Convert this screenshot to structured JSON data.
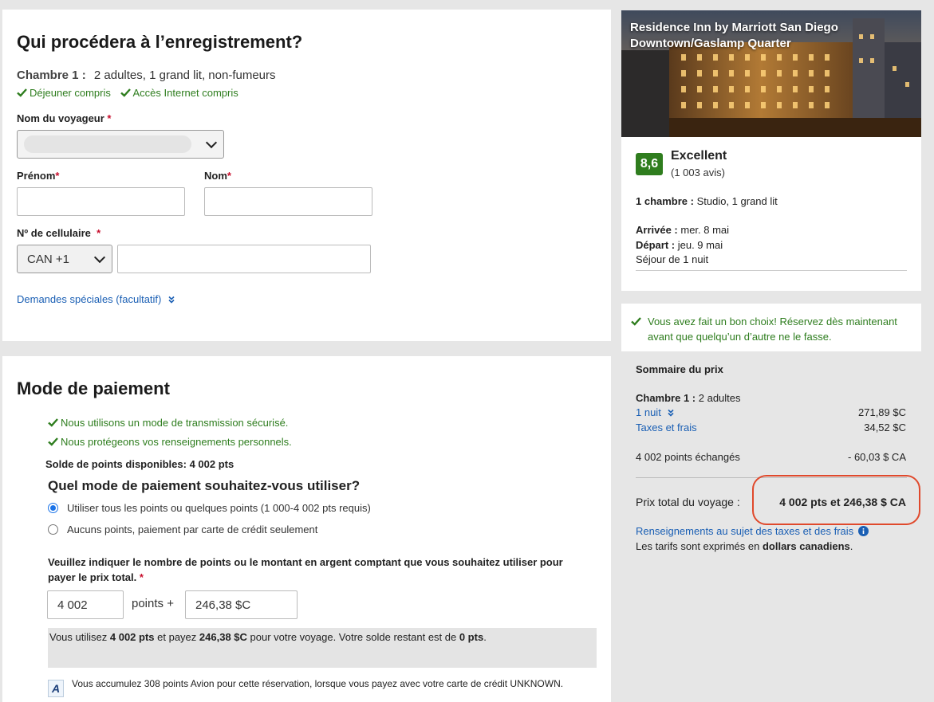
{
  "checkin": {
    "title": "Qui procédera à l’enregistrement?",
    "room_label": "Chambre 1 :",
    "room_desc": "2 adultes, 1 grand lit, non-fumeurs",
    "amenities": [
      "Déjeuner compris",
      "Accès Internet compris"
    ],
    "traveler_label": "Nom du voyageur",
    "firstname_label": "Prénom",
    "lastname_label": "Nom",
    "phone_label": "Nº de cellulaire",
    "phone_code": "CAN +1",
    "special_requests": "Demandes spéciales (facultatif)",
    "required_mark": "*"
  },
  "payment": {
    "title": "Mode de paiement",
    "secure_1": "Nous utilisons un mode de transmission sécurisé.",
    "secure_2": "Nous protégeons vos renseignements personnels.",
    "balance_label": "Solde de points disponibles: 4 002 pts",
    "question": "Quel mode de paiement souhaitez-vous utiliser?",
    "option_points": "Utiliser tous les points ou quelques points (1 000-4 002 pts requis)",
    "option_card": "Aucuns points, paiement par carte de crédit seulement",
    "amount_prompt": "Veuillez indiquer le nombre de points ou le montant en argent comptant que vous souhaitez utiliser pour payer le prix total.",
    "points_value": "4 002",
    "points_plus": "points +",
    "cash_value": "246,38 $C",
    "summary_pre": "Vous utilisez ",
    "summary_points": "4 002 pts",
    "summary_mid": " et payez ",
    "summary_cash": "246,38 $C",
    "summary_post": " pour votre voyage. Votre solde restant est de ",
    "summary_remaining": "0 pts",
    "summary_end": ".",
    "avion_note": "Vous accumulez 308 points Avion pour cette réservation, lorsque vous payez avec votre carte de crédit UNKNOWN.",
    "avion_badge": "A"
  },
  "hotel": {
    "name": "Residence Inn by Marriott San Diego Downtown/Gaslamp Quarter",
    "rating": "8,6",
    "rating_word": "Excellent",
    "reviews": "(1 003 avis)",
    "room_label": "1 chambre :",
    "room_value": " Studio, 1 grand lit",
    "arrival_label": "Arrivée :",
    "arrival_value": " mer. 8 mai",
    "departure_label": "Départ :",
    "departure_value": " jeu. 9 mai",
    "stay": "Séjour de 1 nuit"
  },
  "choice": {
    "message": "Vous avez fait un bon choix! Réservez dès maintenant avant que quelqu’un d’autre ne le fasse."
  },
  "price": {
    "title": "Sommaire du prix",
    "room_label": "Chambre 1 :",
    "room_value": " 2 adultes",
    "night_label": "1 nuit",
    "night_value": "271,89 $C",
    "taxes_label": "Taxes et frais",
    "taxes_value": "34,52 $C",
    "points_label": "4 002 points échangés",
    "points_value": "- 60,03 $ CA",
    "total_label": "Prix total du voyage :",
    "total_value": "4 002 pts et 246,38 $ CA",
    "taxes_info": "Renseignements au sujet des taxes et des frais",
    "currency_pre": "Les tarifs sont exprimés en ",
    "currency_bold": "dollars canadiens",
    "currency_end": "."
  },
  "colors": {
    "accent_green": "#2e7d1e",
    "link_blue": "#1a5fb4",
    "highlight_red": "#e0492c",
    "rating_green": "#2f7d1e"
  }
}
